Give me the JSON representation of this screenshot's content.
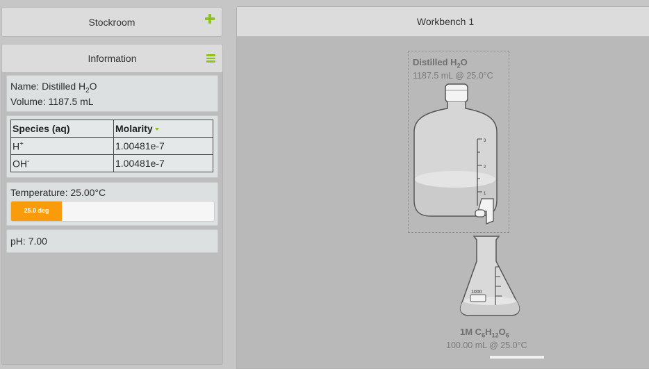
{
  "stockroom": {
    "title": "Stockroom",
    "add_icon": "plus-icon"
  },
  "information": {
    "title": "Information",
    "menu_icon": "menu-icon",
    "name_label": "Name: Distilled H",
    "name_sub": "2",
    "name_tail": "O",
    "volume_text": "Volume: 1187.5 mL",
    "species_table": {
      "headers": [
        "Species (aq)",
        "Molarity"
      ],
      "rows": [
        {
          "species": "H",
          "charge": "+",
          "molarity": "1.00481e-7"
        },
        {
          "species": "OH",
          "charge": "-",
          "molarity": "1.00481e-7"
        }
      ]
    },
    "temperature_text": "Temperature: 25.00°C",
    "temperature_bar_label": "25.0 deg",
    "temperature_fraction": 0.25,
    "ph_text": "pH: 7.00"
  },
  "workbench": {
    "title": "Workbench 1",
    "carboy": {
      "name_a": "Distilled H",
      "name_sub": "2",
      "name_b": "O",
      "sub_text": "1187.5 mL @ 25.0°C",
      "marks": [
        "3",
        "2",
        "1"
      ]
    },
    "flask": {
      "name_a": "1M C",
      "sub1": "6",
      "name_b": "H",
      "sub2": "12",
      "name_c": "O",
      "sub3": "6",
      "sub_text": "100.00 mL @ 25.0°C",
      "mark_label": "1000"
    }
  },
  "colors": {
    "accent_green": "#8cc21b",
    "temperature_orange": "#f99c0c"
  }
}
